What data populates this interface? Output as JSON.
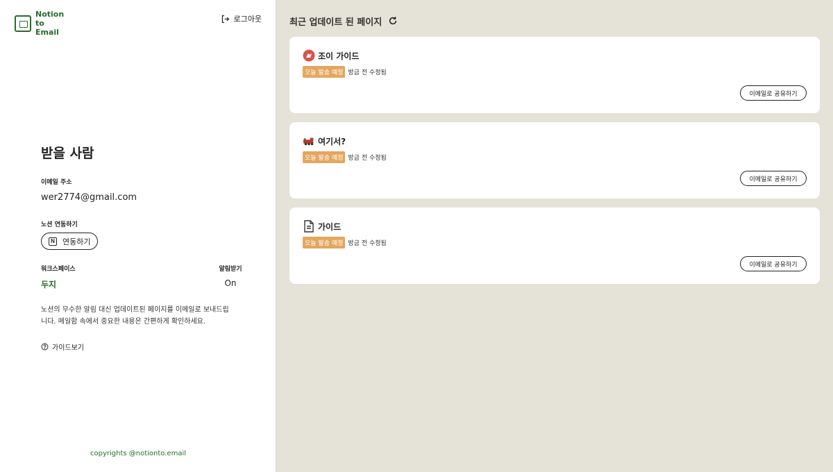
{
  "brand": {
    "line1": "Notion",
    "line2": "to Email"
  },
  "header": {
    "logout_label": "로그아웃"
  },
  "recipient": {
    "heading": "받을 사람",
    "email_label": "이메일 주소",
    "email_value": "wer2774@gmail.com",
    "notion_label": "노션 연동하기",
    "connect_button": "연동하기",
    "workspace_label": "워크스페이스",
    "workspace_value": "두지",
    "notify_label": "알림받기",
    "notify_value": "On",
    "description": "노션의 무수한 알림 대신 업데이트된 페이지를 이메일로 보내드립니다. 메일함 속에서 중요한 내용은 간편하게 확인하세요.",
    "guide_label": "가이드보기"
  },
  "footer": {
    "copyright": "copyrights @notionto.email"
  },
  "main": {
    "title": "최근 업데이트 된 페이지",
    "pages": [
      {
        "icon": "red-joey-icon",
        "title": "조이 가이드",
        "badge": "오늘 발송 예정",
        "modified": "방금 전 수정됨",
        "share": "이메일로 공유하기"
      },
      {
        "icon": "train-icon",
        "title": "여기서?",
        "badge": "오늘 발송 예정",
        "modified": "방금 전 수정됨",
        "share": "이메일로 공유하기"
      },
      {
        "icon": "document-icon",
        "title": "가이드",
        "badge": "오늘 발송 예정",
        "modified": "방금 전 수정됨",
        "share": "이메일로 공유하기"
      }
    ]
  },
  "colors": {
    "brand_green": "#2a6b2a",
    "badge_orange": "#e5a65d",
    "background": "#e5e2d7"
  }
}
